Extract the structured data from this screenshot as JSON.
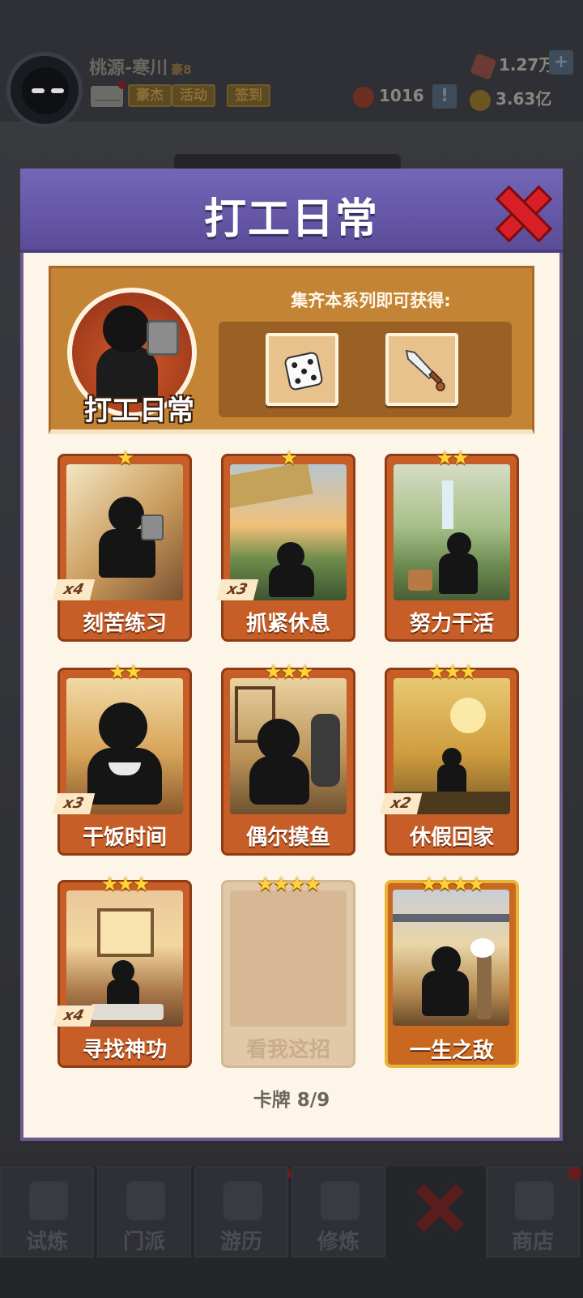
{
  "header": {
    "player_name": "桃源-寒川",
    "player_title": "豪8",
    "buttons": [
      "豪杰",
      "活动",
      "签到"
    ],
    "resources": {
      "gems": "1.27万",
      "tokens": "1016",
      "gold": "3.63亿"
    },
    "plus_symbol": "+",
    "info_symbol": "!"
  },
  "modal": {
    "title": "打工日常",
    "reward_panel": {
      "series_label": "打工日常",
      "caption": "集齐本系列即可获得:",
      "rewards": [
        {
          "icon": "dice-icon"
        },
        {
          "icon": "sword-icon"
        }
      ]
    },
    "cards": [
      {
        "name": "刻苦练习",
        "stars": "★",
        "count": "x4",
        "locked": false
      },
      {
        "name": "抓紧休息",
        "stars": "★",
        "count": "x3",
        "locked": false
      },
      {
        "name": "努力干活",
        "stars": "★★",
        "count": "",
        "locked": false
      },
      {
        "name": "干饭时间",
        "stars": "★★",
        "count": "x3",
        "locked": false
      },
      {
        "name": "偶尔摸鱼",
        "stars": "★★★",
        "count": "",
        "locked": false
      },
      {
        "name": "休假回家",
        "stars": "★★★",
        "count": "x2",
        "locked": false
      },
      {
        "name": "寻找神功",
        "stars": "★★★",
        "count": "x4",
        "locked": false
      },
      {
        "name": "看我这招",
        "stars": "★★★★",
        "count": "",
        "locked": true
      },
      {
        "name": "一生之敌",
        "stars": "★★★★",
        "count": "",
        "locked": false
      }
    ],
    "progress_label": "卡牌",
    "progress_value": "8/9"
  },
  "bottom_nav": {
    "items": [
      "试炼",
      "门派",
      "游历",
      "修炼",
      "",
      "商店"
    ]
  },
  "colors": {
    "modal_header": "#6659a8",
    "card_frame": "#c85e27",
    "star": "#ffd33a",
    "close_red": "#d81f26"
  }
}
